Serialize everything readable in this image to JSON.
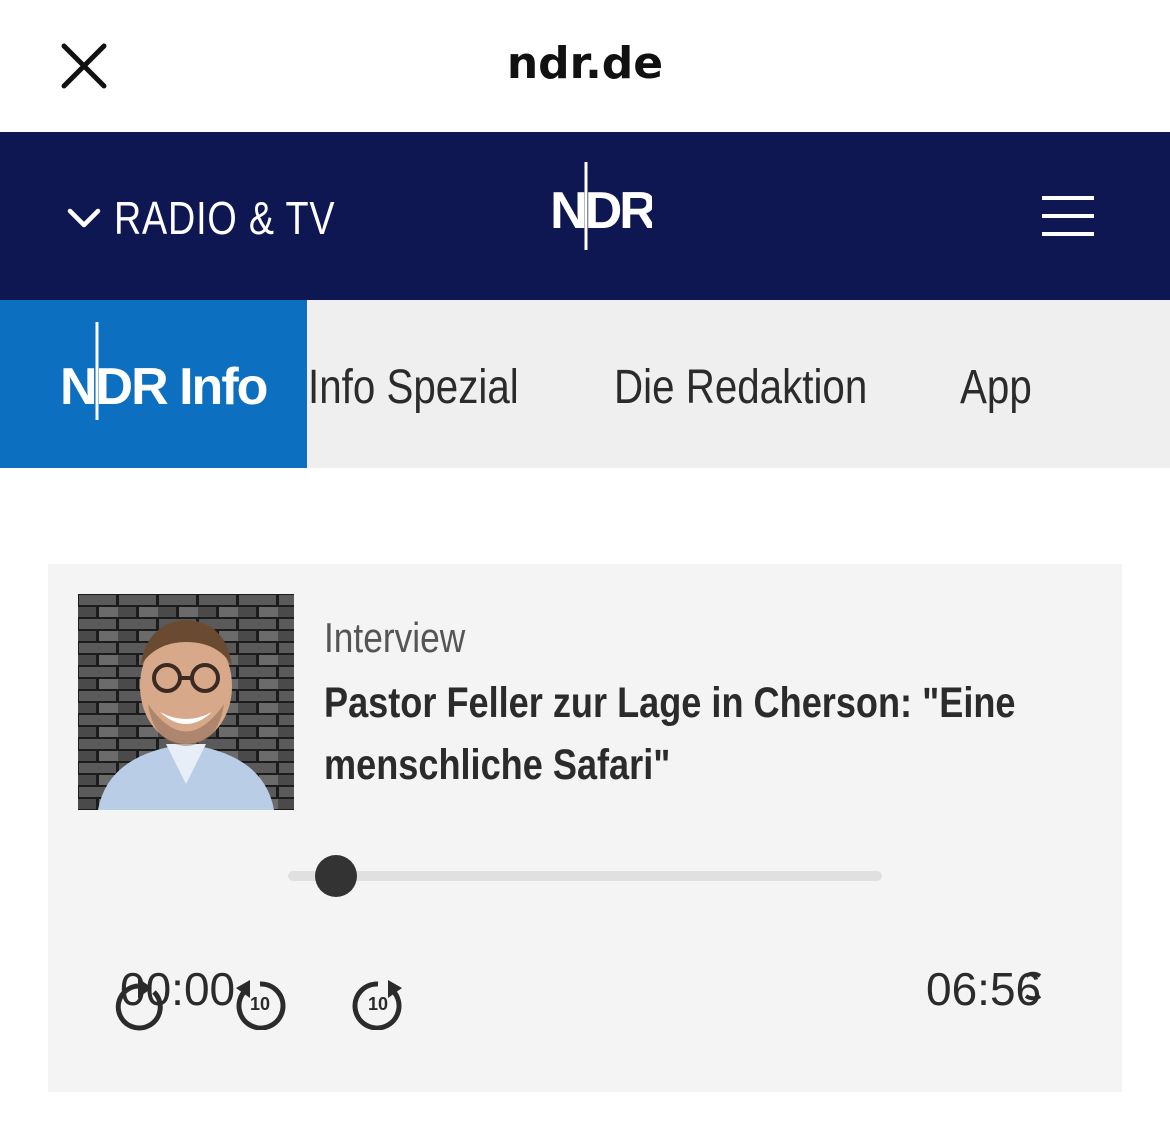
{
  "browser": {
    "site": "ndr.de",
    "close_icon": "close-icon"
  },
  "header": {
    "menu_label": "RADIO & TV",
    "logo_text": "NDR",
    "background": "#0f1752",
    "menu_icon": "hamburger-icon"
  },
  "subnav": {
    "brand": "NDR Info",
    "brand_color": "#0d6fbf",
    "items": [
      {
        "label": "Info Spezial"
      },
      {
        "label": "Die Redaktion"
      },
      {
        "label": "App"
      }
    ]
  },
  "player": {
    "category": "Interview",
    "title": "Pastor Feller zur Lage in Cherson: \"Eine menschliche Safari\"",
    "current_time": "00:00",
    "total_time": "06:56",
    "progress": 0,
    "skip_back_label": "10",
    "skip_forward_label": "10"
  }
}
